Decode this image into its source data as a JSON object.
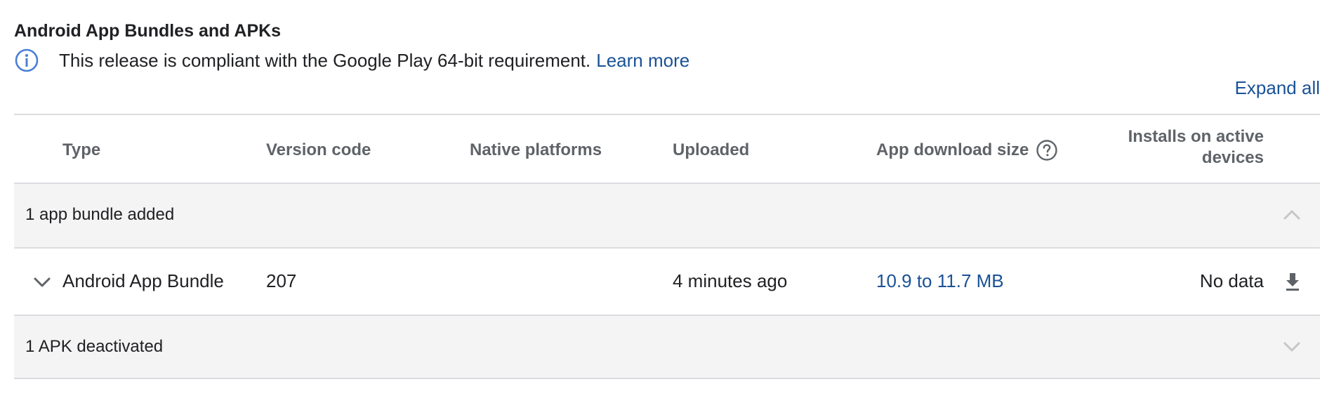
{
  "section": {
    "title": "Android App Bundles and APKs",
    "notice_text": "This release is compliant with the Google Play 64-bit requirement.",
    "learn_more": "Learn more",
    "expand_all": "Expand all"
  },
  "table": {
    "columns": {
      "type": "Type",
      "version_code": "Version code",
      "native_platforms": "Native platforms",
      "uploaded": "Uploaded",
      "app_download_size": "App download size",
      "installs_line1": "Installs on active",
      "installs_line2": "devices"
    },
    "groups": [
      {
        "label": "1 app bundle added",
        "expanded": true,
        "rows": [
          {
            "type": "Android App Bundle",
            "version_code": "207",
            "native_platforms": "",
            "uploaded": "4 minutes ago",
            "download_size": "10.9 to 11.7 MB",
            "installs": "No data"
          }
        ]
      },
      {
        "label": "1 APK deactivated",
        "expanded": false,
        "rows": []
      }
    ]
  },
  "icons": {
    "notice": "info-icon",
    "help": "help-circle-icon",
    "collapse": "chevron-up-icon",
    "expand": "chevron-down-icon",
    "download": "download-icon"
  },
  "colors": {
    "link": "#1a5296",
    "info_icon": "#4a7fd6",
    "group_background": "#f4f4f4",
    "divider": "#dadce0"
  }
}
